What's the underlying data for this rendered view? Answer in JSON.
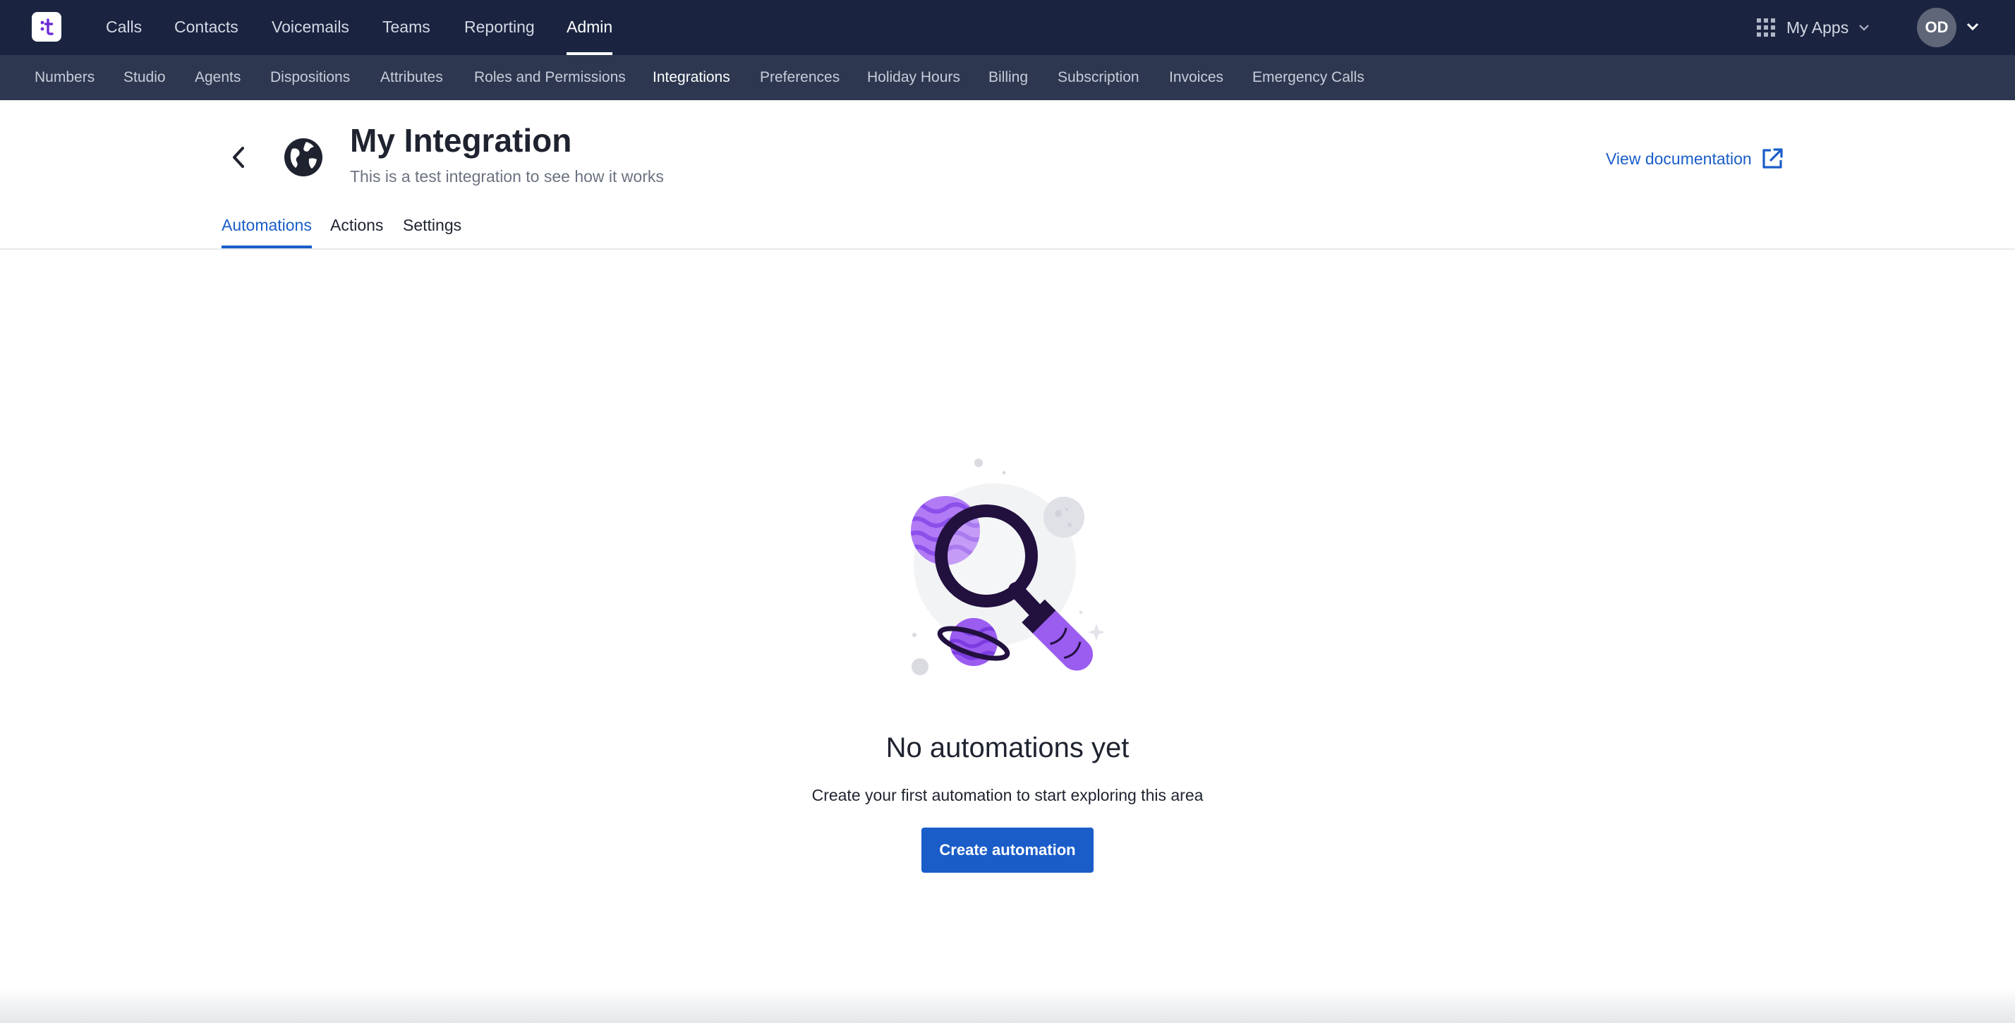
{
  "top_nav": {
    "logo_icon": "aircall-logo-icon",
    "items": [
      {
        "label": "Calls",
        "active": false
      },
      {
        "label": "Contacts",
        "active": false
      },
      {
        "label": "Voicemails",
        "active": false
      },
      {
        "label": "Teams",
        "active": false
      },
      {
        "label": "Reporting",
        "active": false
      },
      {
        "label": "Admin",
        "active": true
      }
    ],
    "apps_label": "My Apps",
    "apps_icon": "apps-grid-icon",
    "user_initials": "OD"
  },
  "sub_nav": {
    "items": [
      {
        "label": "Numbers",
        "active": false
      },
      {
        "label": "Studio",
        "active": false
      },
      {
        "label": "Agents",
        "active": false
      },
      {
        "label": "Dispositions",
        "active": false
      },
      {
        "label": "Attributes",
        "active": false
      },
      {
        "label": "Roles and Permissions",
        "active": false
      },
      {
        "label": "Integrations",
        "active": true
      },
      {
        "label": "Preferences",
        "active": false
      },
      {
        "label": "Holiday Hours",
        "active": false
      },
      {
        "label": "Billing",
        "active": false
      },
      {
        "label": "Subscription",
        "active": false
      },
      {
        "label": "Invoices",
        "active": false
      },
      {
        "label": "Emergency Calls",
        "active": false
      }
    ]
  },
  "header": {
    "title": "My Integration",
    "subtitle": "This is a test integration to see how it works",
    "integration_icon": "globe-icon",
    "doc_link": "View documentation",
    "doc_icon": "external-link-icon"
  },
  "tabs": [
    {
      "label": "Automations",
      "active": true
    },
    {
      "label": "Actions",
      "active": false
    },
    {
      "label": "Settings",
      "active": false
    }
  ],
  "empty_state": {
    "illustration": "magnifier-planets-illustration",
    "title": "No automations yet",
    "description": "Create your first automation to start exploring this area",
    "button_label": "Create automation"
  },
  "colors": {
    "topbar": "#1a2440",
    "subbar": "#2d3850",
    "accent": "#1a5dc9",
    "illustration_purple": "#9b5cf0",
    "illustration_dark": "#22103f"
  }
}
